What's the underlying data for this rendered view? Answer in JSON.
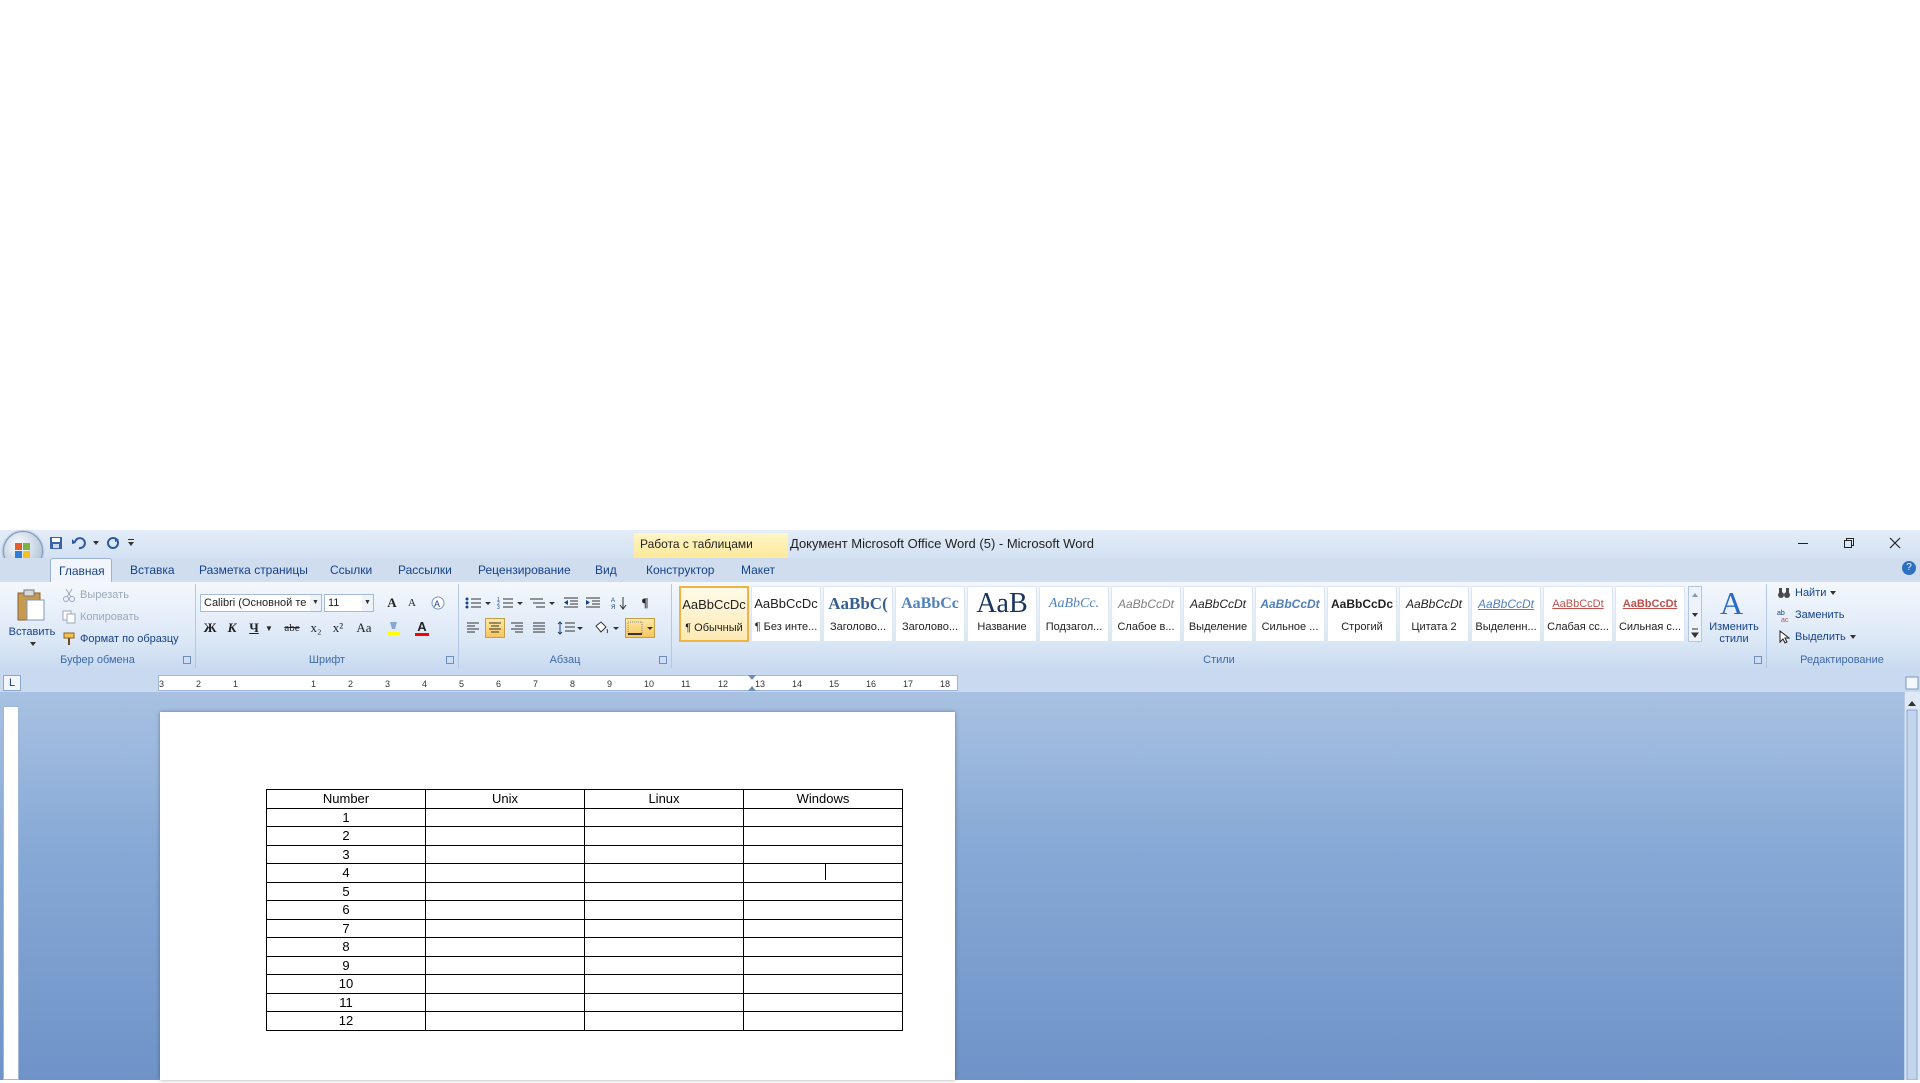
{
  "window": {
    "title": "Документ Microsoft Office Word (5) - Microsoft Word",
    "contextual_tab_group": "Работа с таблицами"
  },
  "icons": {
    "office_button": "office-logo-icon",
    "save": "save-icon",
    "undo": "undo-icon",
    "redo": "redo-icon",
    "customize": "qat-dropdown-icon",
    "minimize": "minimize-icon",
    "restore": "restore-icon",
    "close": "close-icon",
    "help": "help-icon"
  },
  "tabs": [
    {
      "label": "Главная",
      "active": true
    },
    {
      "label": "Вставка"
    },
    {
      "label": "Разметка страницы"
    },
    {
      "label": "Ссылки"
    },
    {
      "label": "Рассылки"
    },
    {
      "label": "Рецензирование"
    },
    {
      "label": "Вид"
    },
    {
      "label": "Конструктор"
    },
    {
      "label": "Макет"
    }
  ],
  "clipboard": {
    "group_label": "Буфер обмена",
    "paste": "Вставить",
    "cut": "Вырезать",
    "copy": "Копировать",
    "format_painter": "Формат по образцу"
  },
  "font": {
    "group_label": "Шрифт",
    "font_name": "Calibri (Основной те",
    "font_size": "11",
    "grow": "A",
    "shrink": "A",
    "bold": "Ж",
    "italic": "К",
    "underline": "Ч",
    "strike": "abe",
    "subscript": "x₂",
    "superscript": "x²",
    "change_case": "Aa",
    "font_color": "A",
    "highlight_color": "#ffff00",
    "font_color_value": "#ff0000"
  },
  "paragraph": {
    "group_label": "Абзац",
    "show_marks": "¶"
  },
  "styles": {
    "group_label": "Стили",
    "items": [
      {
        "sample": "AaBbCcDc",
        "name": "¶ Обычный",
        "active": true
      },
      {
        "sample": "AaBbCcDc",
        "name": "¶ Без инте..."
      },
      {
        "sample": "AaBbC(",
        "name": "Заголово..."
      },
      {
        "sample": "AaBbCc",
        "name": "Заголово..."
      },
      {
        "sample": "AaB",
        "name": "Название"
      },
      {
        "sample": "AaBbCc.",
        "name": "Подзагол..."
      },
      {
        "sample": "AaBbCcDt",
        "name": "Слабое в..."
      },
      {
        "sample": "AaBbCcDt",
        "name": "Выделение"
      },
      {
        "sample": "AaBbCcDt",
        "name": "Сильное ..."
      },
      {
        "sample": "AaBbCcDc",
        "name": "Строгий"
      },
      {
        "sample": "AaBbCcDt",
        "name": "Цитата 2"
      },
      {
        "sample": "AaBbCcDt",
        "name": "Выделенн..."
      },
      {
        "sample": "AaBbCcDt",
        "name": "Слабая сс..."
      },
      {
        "sample": "AaBbCcDt",
        "name": "Сильная с..."
      }
    ],
    "change_styles_line1": "Изменить",
    "change_styles_line2": "стили"
  },
  "editing": {
    "group_label": "Редактирование",
    "find": "Найти",
    "replace": "Заменить",
    "select": "Выделить"
  },
  "ruler": {
    "corner": "L",
    "marks": [
      "3",
      "2",
      "1",
      "1",
      "2",
      "3",
      "4",
      "5",
      "6",
      "7",
      "8",
      "9",
      "10",
      "11",
      "12",
      "13",
      "14",
      "15",
      "16",
      "17",
      "18"
    ]
  },
  "table": {
    "headers": [
      "Number",
      "Unix",
      "Linux",
      "Windows"
    ],
    "rows": [
      [
        "1",
        "",
        "",
        ""
      ],
      [
        "2",
        "",
        "",
        ""
      ],
      [
        "3",
        "",
        "",
        ""
      ],
      [
        "4",
        "",
        "",
        ""
      ],
      [
        "5",
        "",
        "",
        ""
      ],
      [
        "6",
        "",
        "",
        ""
      ],
      [
        "7",
        "",
        "",
        ""
      ],
      [
        "8",
        "",
        "",
        ""
      ],
      [
        "9",
        "",
        "",
        ""
      ],
      [
        "10",
        "",
        "",
        ""
      ],
      [
        "11",
        "",
        "",
        ""
      ],
      [
        "12",
        "",
        "",
        ""
      ]
    ]
  }
}
